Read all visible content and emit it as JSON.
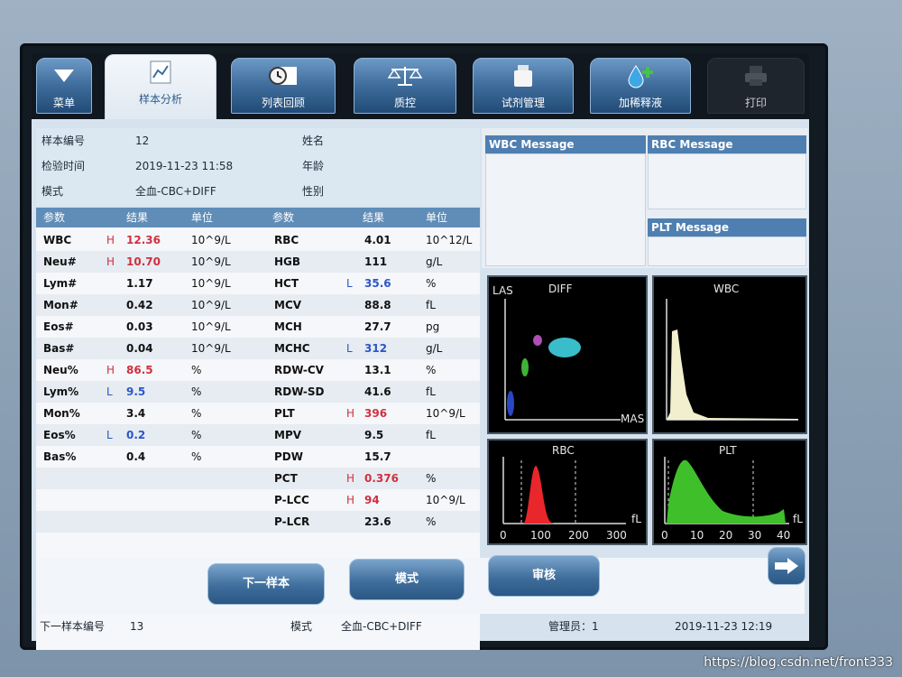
{
  "tabs": [
    {
      "label": "菜单",
      "icon": "menu-down-arrow-icon"
    },
    {
      "label": "样本分析",
      "icon": "sample-analysis-icon"
    },
    {
      "label": "列表回顾",
      "icon": "list-review-icon"
    },
    {
      "label": "质控",
      "icon": "scale-icon"
    },
    {
      "label": "试剂管理",
      "icon": "reagent-bottle-icon"
    },
    {
      "label": "加稀释液",
      "icon": "add-diluent-icon"
    },
    {
      "label": "打印",
      "icon": "printer-icon"
    }
  ],
  "sample": {
    "id_label": "样本编号",
    "id_value": "12",
    "time_label": "检验时间",
    "time_value": "2019-11-23 11:58",
    "mode_label": "模式",
    "mode_value": "全血-CBC+DIFF",
    "name_label": "姓名",
    "age_label": "年龄",
    "sex_label": "性别"
  },
  "table_headers": {
    "param": "参数",
    "result": "结果",
    "unit": "单位",
    "param2": "参数",
    "result2": "结果",
    "unit2": "单位"
  },
  "left_rows": [
    {
      "param": "WBC",
      "flag": "H",
      "result": "12.36",
      "unit": "10^9/L"
    },
    {
      "param": "Neu#",
      "flag": "H",
      "result": "10.70",
      "unit": "10^9/L"
    },
    {
      "param": "Lym#",
      "flag": "",
      "result": "1.17",
      "unit": "10^9/L"
    },
    {
      "param": "Mon#",
      "flag": "",
      "result": "0.42",
      "unit": "10^9/L"
    },
    {
      "param": "Eos#",
      "flag": "",
      "result": "0.03",
      "unit": "10^9/L"
    },
    {
      "param": "Bas#",
      "flag": "",
      "result": "0.04",
      "unit": "10^9/L"
    },
    {
      "param": "Neu%",
      "flag": "H",
      "result": "86.5",
      "unit": "%"
    },
    {
      "param": "Lym%",
      "flag": "L",
      "result": "9.5",
      "unit": "%"
    },
    {
      "param": "Mon%",
      "flag": "",
      "result": "3.4",
      "unit": "%"
    },
    {
      "param": "Eos%",
      "flag": "L",
      "result": "0.2",
      "unit": "%"
    },
    {
      "param": "Bas%",
      "flag": "",
      "result": "0.4",
      "unit": "%"
    }
  ],
  "right_rows": [
    {
      "param": "RBC",
      "flag": "",
      "result": "4.01",
      "unit": "10^12/L"
    },
    {
      "param": "HGB",
      "flag": "",
      "result": "111",
      "unit": "g/L"
    },
    {
      "param": "HCT",
      "flag": "L",
      "result": "35.6",
      "unit": "%"
    },
    {
      "param": "MCV",
      "flag": "",
      "result": "88.8",
      "unit": "fL"
    },
    {
      "param": "MCH",
      "flag": "",
      "result": "27.7",
      "unit": "pg"
    },
    {
      "param": "MCHC",
      "flag": "L",
      "result": "312",
      "unit": "g/L"
    },
    {
      "param": "RDW-CV",
      "flag": "",
      "result": "13.1",
      "unit": "%"
    },
    {
      "param": "RDW-SD",
      "flag": "",
      "result": "41.6",
      "unit": "fL"
    },
    {
      "param": "PLT",
      "flag": "H",
      "result": "396",
      "unit": "10^9/L"
    },
    {
      "param": "MPV",
      "flag": "",
      "result": "9.5",
      "unit": "fL"
    },
    {
      "param": "PDW",
      "flag": "",
      "result": "15.7",
      "unit": ""
    },
    {
      "param": "PCT",
      "flag": "H",
      "result": "0.376",
      "unit": "%"
    },
    {
      "param": "P-LCC",
      "flag": "H",
      "result": "94",
      "unit": "10^9/L"
    },
    {
      "param": "P-LCR",
      "flag": "",
      "result": "23.6",
      "unit": "%"
    }
  ],
  "messages": {
    "wbc": "WBC Message",
    "rbc": "RBC Message",
    "plt": "PLT Message"
  },
  "plots": {
    "diff": {
      "title": "DIFF",
      "ylabel": "LAS",
      "xlabel": "MAS"
    },
    "wbc": {
      "title": "WBC"
    },
    "rbc": {
      "title": "RBC",
      "unit": "fL",
      "ticks": [
        "0",
        "100",
        "200",
        "300"
      ]
    },
    "plt": {
      "title": "PLT",
      "unit": "fL",
      "ticks": [
        "0",
        "10",
        "20",
        "30",
        "40"
      ]
    }
  },
  "buttons": {
    "next": "下一样本",
    "mode": "模式",
    "review": "审核"
  },
  "footer": {
    "next_label": "下一样本编号",
    "next_value": "13",
    "mode_label": "模式",
    "mode_value": "全血-CBC+DIFF",
    "user": "管理员：1",
    "datetime": "2019-11-23 12:19"
  },
  "watermark": "https://blog.csdn.net/front333",
  "colors": {
    "high": "#d0303f",
    "low": "#2c55c8",
    "header": "#5f8db8",
    "rbc_curve": "#e8262b",
    "plt_curve": "#3fbf2a",
    "wbc_curve": "#f2efcf"
  }
}
